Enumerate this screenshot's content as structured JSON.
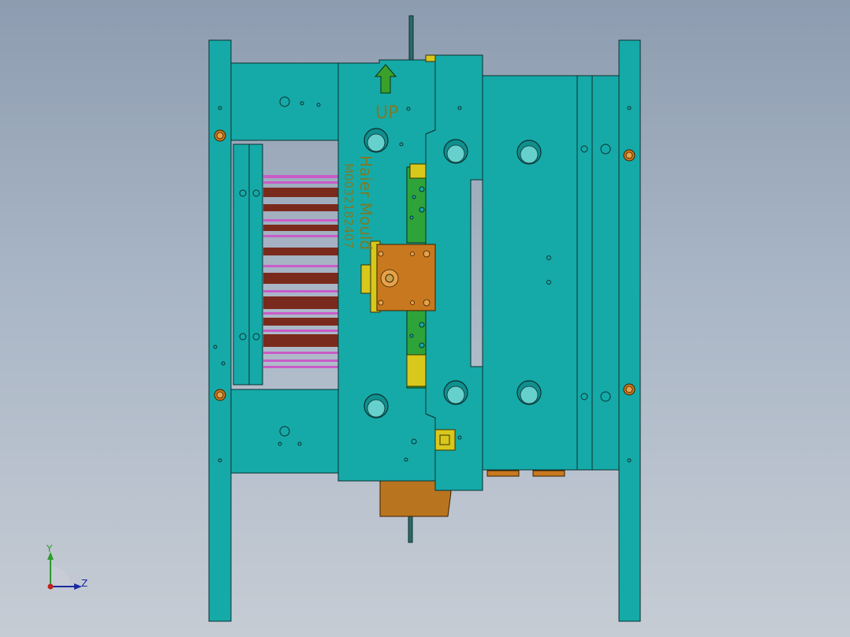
{
  "viewport": {
    "background": "#a9b6c6",
    "plate_color": "#15aaa8",
    "edge_color": "#0d3030"
  },
  "part_labels": {
    "up_text": "UP",
    "brand_text": "Haier Mould",
    "mould_number": "M0032182407"
  },
  "triad": {
    "y_label": "Y",
    "z_label": "Z",
    "icon": "coordinate-triad-icon"
  },
  "colors": {
    "arrow": "#3aa02a",
    "brass": "#c8781e",
    "slider": "#2ea33a",
    "yellow": "#d8c81c",
    "cable_dark": "#7a2a1c",
    "cable_pink": "#c95cc8"
  }
}
